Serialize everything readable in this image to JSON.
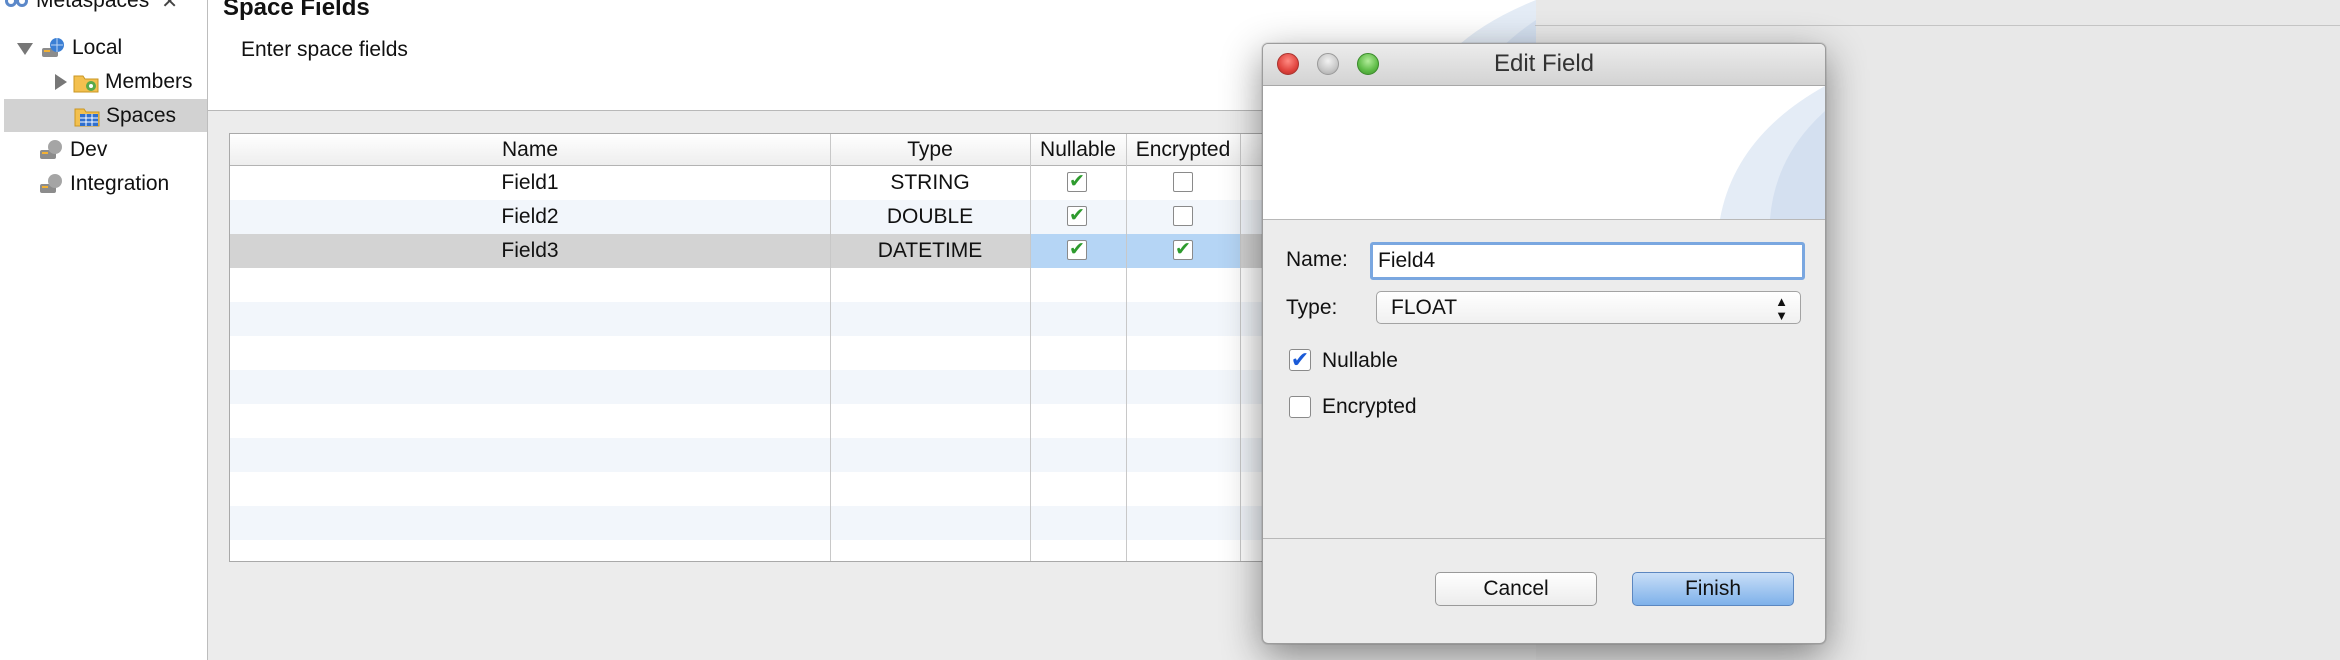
{
  "tree": {
    "root_label": "Metaspaces",
    "items": [
      {
        "label": "Local",
        "expanded": true
      },
      {
        "label": "Members"
      },
      {
        "label": "Spaces",
        "selected": true
      },
      {
        "label": "Dev"
      },
      {
        "label": "Integration"
      }
    ]
  },
  "wizard": {
    "title": "Space Fields",
    "description": "Enter space fields"
  },
  "table": {
    "columns": [
      "Name",
      "Type",
      "Nullable",
      "Encrypted"
    ],
    "rows": [
      {
        "name": "Field1",
        "type": "STRING",
        "nullable": true,
        "encrypted": false
      },
      {
        "name": "Field2",
        "type": "DOUBLE",
        "nullable": true,
        "encrypted": false
      },
      {
        "name": "Field3",
        "type": "DATETIME",
        "nullable": true,
        "encrypted": true
      }
    ],
    "check_glyph": "✔"
  },
  "dialog": {
    "title": "Edit Field",
    "name_label": "Name:",
    "name_value": "Field4",
    "type_label": "Type:",
    "type_value": "FLOAT",
    "nullable_label": "Nullable",
    "nullable_checked": true,
    "encrypted_label": "Encrypted",
    "encrypted_checked": false,
    "cancel_label": "Cancel",
    "finish_label": "Finish",
    "check_glyph": "✔"
  },
  "colors": {
    "selection_blue": "#b5d5f5",
    "check_green": "#2e9b2e",
    "traffic_close": "#e0443e",
    "traffic_minimize": "#c7c7c7",
    "traffic_zoom": "#5dbb46"
  }
}
